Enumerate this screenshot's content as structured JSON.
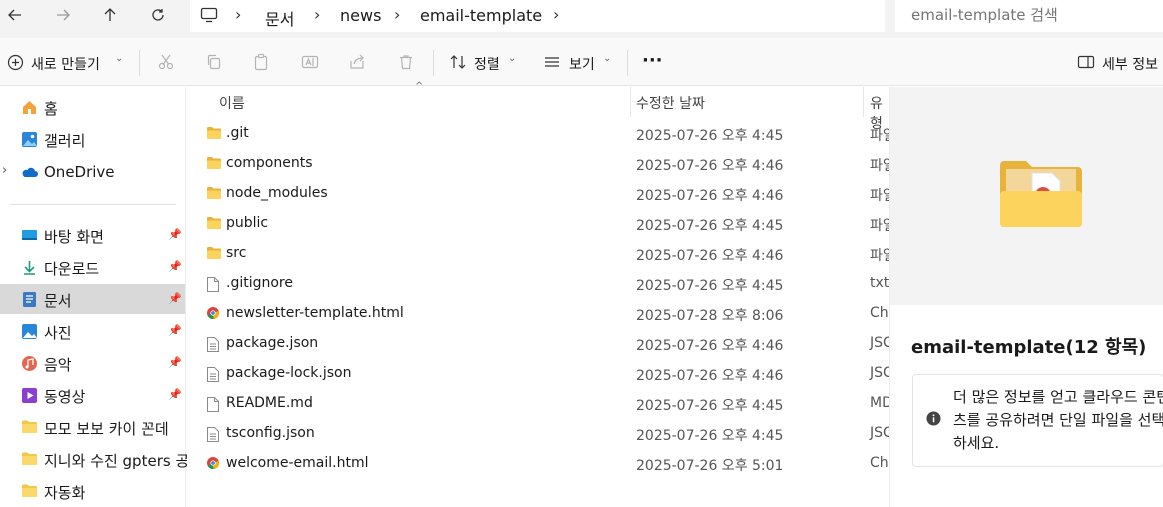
{
  "nav": {
    "back": "back-arrow",
    "forward": "forward-arrow",
    "up": "up-arrow",
    "refresh": "refresh"
  },
  "breadcrumb": {
    "items": [
      "문서",
      "news",
      "email-template"
    ]
  },
  "search": {
    "placeholder": "email-template 검색"
  },
  "toolbar": {
    "new_label": "새로 만들기",
    "sort_label": "정렬",
    "view_label": "보기",
    "more_label": "···",
    "details_label": "세부 정보"
  },
  "sidebar": {
    "items": [
      {
        "label": "홈",
        "icon": "home-icon"
      },
      {
        "label": "갤러리",
        "icon": "gallery-icon"
      },
      {
        "label": "OneDrive",
        "icon": "cloud-icon"
      },
      {
        "label": "바탕 화면",
        "icon": "desktop-icon"
      },
      {
        "label": "다운로드",
        "icon": "download-icon"
      },
      {
        "label": "문서",
        "icon": "document-icon"
      },
      {
        "label": "사진",
        "icon": "pictures-icon"
      },
      {
        "label": "음악",
        "icon": "music-icon"
      },
      {
        "label": "동영상",
        "icon": "video-icon"
      },
      {
        "label": "모모 보보 카이 꼰데",
        "icon": "folder-icon"
      },
      {
        "label": "지니와 수진 gpters 공",
        "icon": "folder-icon"
      },
      {
        "label": "자동화",
        "icon": "folder-icon"
      }
    ]
  },
  "columns": {
    "name": "이름",
    "date": "수정한 날짜",
    "type": "유형"
  },
  "files": [
    {
      "name": ".git",
      "date": "2025-07-26 오후 4:45",
      "type": "파일",
      "kind": "folder"
    },
    {
      "name": "components",
      "date": "2025-07-26 오후 4:46",
      "type": "파일",
      "kind": "folder"
    },
    {
      "name": "node_modules",
      "date": "2025-07-26 오후 4:46",
      "type": "파일",
      "kind": "folder"
    },
    {
      "name": "public",
      "date": "2025-07-26 오후 4:45",
      "type": "파일",
      "kind": "folder"
    },
    {
      "name": "src",
      "date": "2025-07-26 오후 4:46",
      "type": "파일",
      "kind": "folder"
    },
    {
      "name": ".gitignore",
      "date": "2025-07-26 오후 4:45",
      "type": "txt",
      "kind": "file"
    },
    {
      "name": "newsletter-template.html",
      "date": "2025-07-28 오후 8:06",
      "type": "Ch",
      "kind": "chrome"
    },
    {
      "name": "package.json",
      "date": "2025-07-26 오후 4:46",
      "type": "JSC",
      "kind": "text"
    },
    {
      "name": "package-lock.json",
      "date": "2025-07-26 오후 4:46",
      "type": "JSC",
      "kind": "text"
    },
    {
      "name": "README.md",
      "date": "2025-07-26 오후 4:45",
      "type": "MD",
      "kind": "file"
    },
    {
      "name": "tsconfig.json",
      "date": "2025-07-26 오후 4:45",
      "type": "JSC",
      "kind": "text"
    },
    {
      "name": "welcome-email.html",
      "date": "2025-07-26 오후 5:01",
      "type": "Ch",
      "kind": "chrome"
    }
  ],
  "details": {
    "title": "email-template(12 항목)",
    "info": "더 많은 정보를 얻고 클라우드 콘텐츠를 공유하려면 단일 파일을 선택하세요."
  },
  "colors": {
    "folder": "#f4c64a",
    "selected": "#d9d9d9",
    "accent": "#0067c0"
  }
}
